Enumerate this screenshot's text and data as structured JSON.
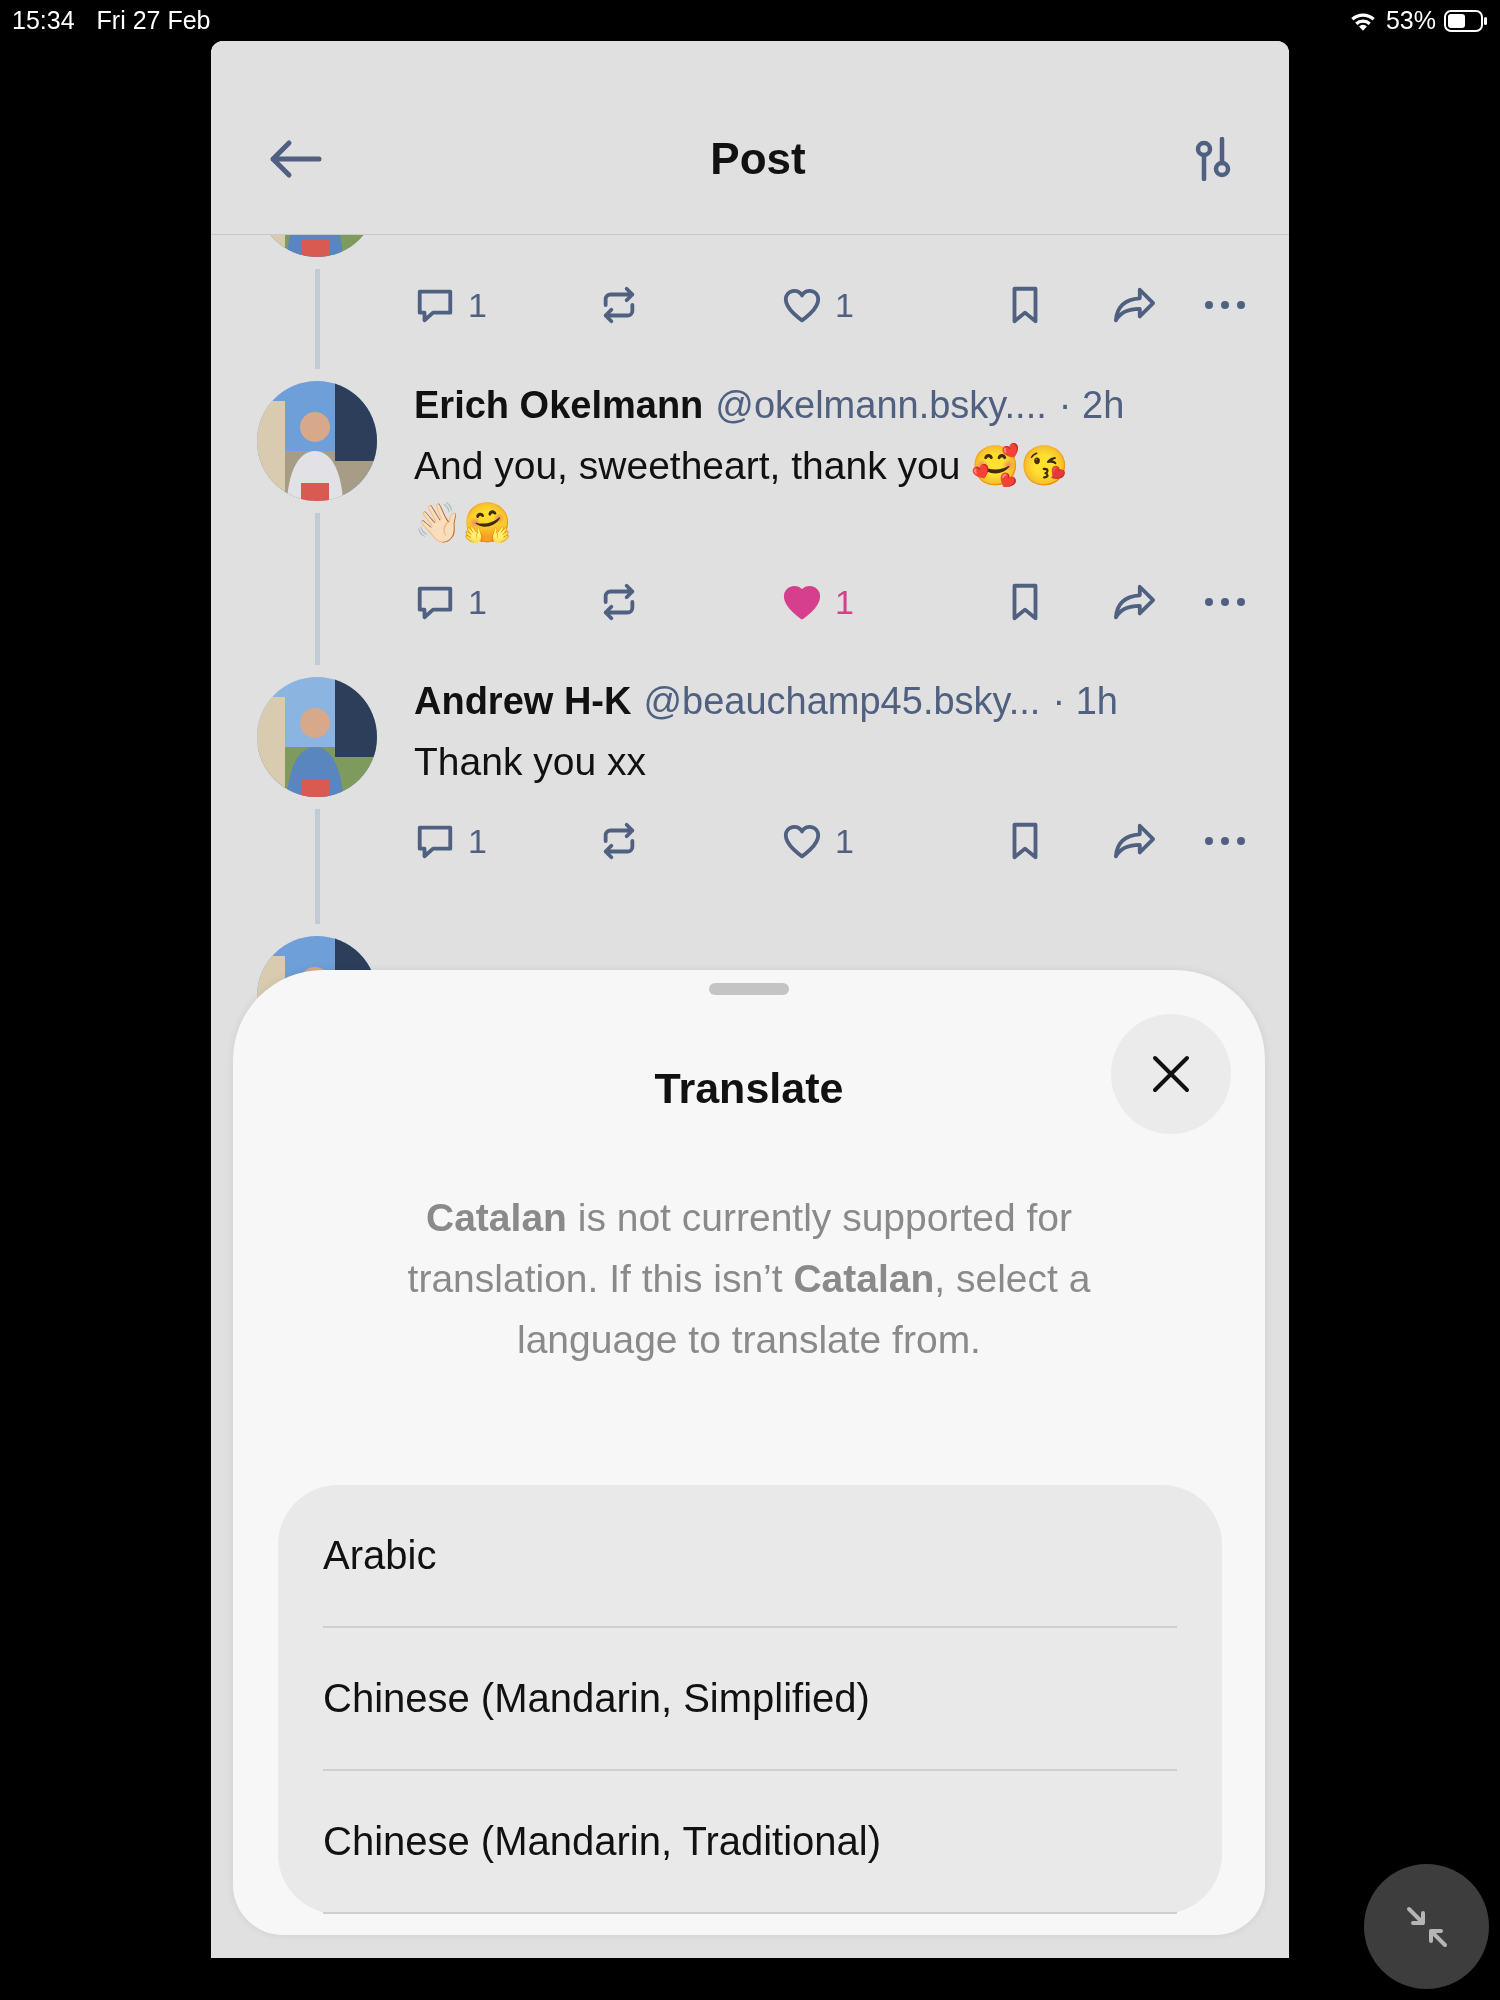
{
  "status_bar": {
    "time": "15:34",
    "date": "Fri 27 Feb",
    "battery": "53%"
  },
  "header": {
    "title": "Post"
  },
  "posts": [
    {
      "kind": "tail",
      "replies": "1",
      "likes": "1",
      "liked": false
    },
    {
      "kind": "full",
      "name": "Erich Okelmann",
      "handle": "@okelmann.bsky....",
      "time": "· 2h",
      "text": "And you, sweetheart, thank you 🥰😘 👋🏻🤗",
      "replies": "1",
      "likes": "1",
      "liked": true
    },
    {
      "kind": "full",
      "name": "Andrew H-K",
      "handle": "@beauchamp45.bsky...",
      "time": "· 1h",
      "text": "Thank you xx",
      "replies": "1",
      "likes": "1",
      "liked": false
    },
    {
      "kind": "head"
    }
  ],
  "sheet": {
    "title": "Translate",
    "message": "**Catalan** is not currently supported for translation. If this isn’t **Catalan**, select a language to translate from.",
    "languages": [
      "Arabic",
      "Chinese (Mandarin, Simplified)",
      "Chinese (Mandarin, Traditional)"
    ]
  }
}
